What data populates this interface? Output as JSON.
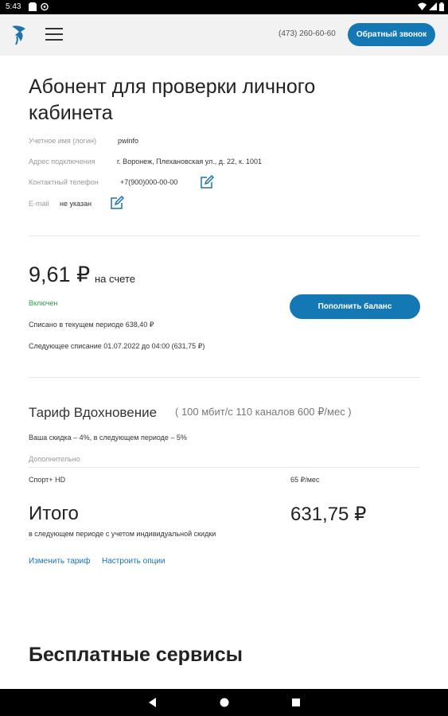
{
  "status_bar": {
    "time": "5:43"
  },
  "header": {
    "phone": "(473) 260-60-60",
    "callback_label": "Обратный звонок"
  },
  "profile": {
    "title": "Абонент для проверки личного кабинета",
    "login_label": "Учетное имя (логин)",
    "login_value": "pwinfo",
    "address_label": "Адрес подключения",
    "address_value": "г. Воронеж, Плехановская ул., д. 22, к. 1001",
    "phone_label": "Контактный телефон",
    "phone_value": "+7(900)000-00-00",
    "email_label": "E-mail",
    "email_value": "не указан"
  },
  "balance": {
    "amount": "9,61 ₽",
    "suffix": "на счете",
    "status": "Включен",
    "charged_period": "Списано в текущем периоде 638,40 ₽",
    "next_charge": "Следующее списание 01.07.2022 до 04:00 (631,75 ₽)",
    "topup_label": "Пополнить баланс"
  },
  "tariff": {
    "name": "Тариф Вдохновение",
    "params": "( 100 мбит/с  110 каналов  600 ₽/мес )",
    "discount": "Ваша скидка – 4%, в следующем периоде – 5%",
    "additional_label": "Дополнительно",
    "option_name": "Спорт+ HD",
    "option_price": "65 ₽/мес",
    "total_label": "Итого",
    "total_value": "631,75 ₽",
    "total_note": "в следующем периоде с учетом индивидуальной скидки",
    "change_link": "Изменить тариф",
    "options_link": "Настроить опции"
  },
  "services": {
    "title": "Бесплатные сервисы"
  }
}
